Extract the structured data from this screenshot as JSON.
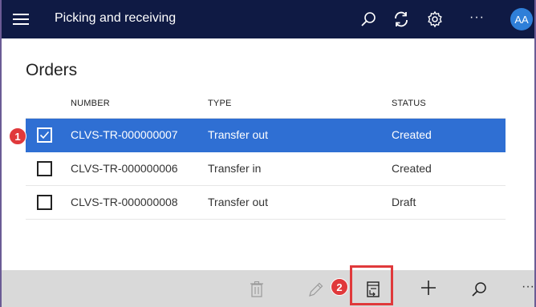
{
  "header": {
    "title": "Picking and receiving",
    "more_label": "···",
    "avatar_initials": "AA",
    "icons": [
      "hamburger-menu-icon",
      "search-icon",
      "refresh-icon",
      "gear-icon",
      "more-icon"
    ]
  },
  "page": {
    "title": "Orders"
  },
  "table": {
    "columns": [
      "NUMBER",
      "TYPE",
      "STATUS"
    ],
    "rows": [
      {
        "number": "CLVS-TR-000000007",
        "type": "Transfer out",
        "status": "Created",
        "selected": true
      },
      {
        "number": "CLVS-TR-000000006",
        "type": "Transfer in",
        "status": "Created",
        "selected": false
      },
      {
        "number": "CLVS-TR-000000008",
        "type": "Transfer out",
        "status": "Draft",
        "selected": false
      }
    ]
  },
  "appbar": {
    "icons": [
      "delete-icon",
      "edit-icon",
      "details-document-icon",
      "add-icon",
      "search-icon",
      "more-icon"
    ],
    "more_label": "···"
  },
  "annotations": {
    "step1": "1",
    "step2": "2",
    "highlight_color": "#e0393b"
  },
  "colors": {
    "header_bg": "#0f1a44",
    "selected_row": "#2f6fd3",
    "avatar_bg": "#2f7fd8",
    "appbar_bg": "#d9d9d9"
  }
}
